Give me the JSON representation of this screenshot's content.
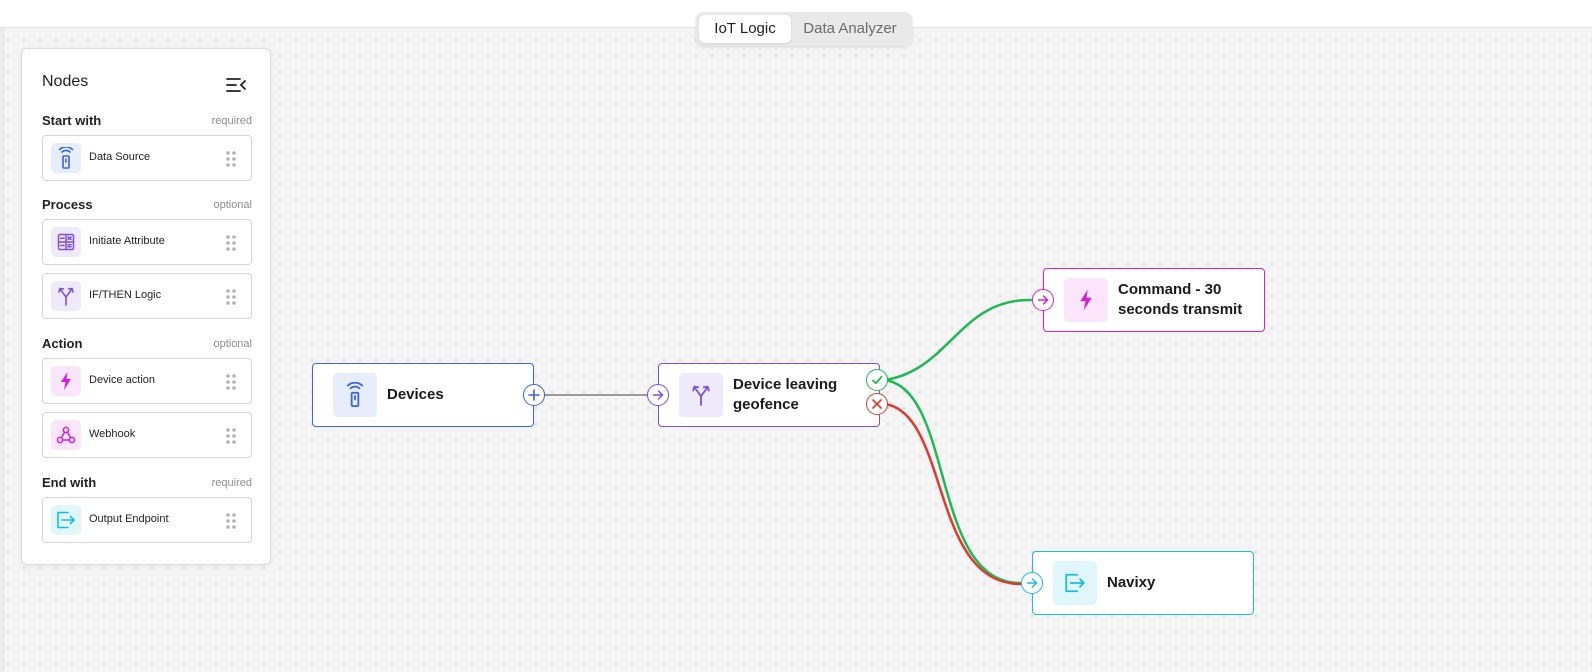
{
  "tabs": [
    "IoT Logic",
    "Data Analyzer"
  ],
  "active_tab": "IoT Logic",
  "panel": {
    "title": "Nodes",
    "sections": [
      {
        "name": "Start with",
        "tag": "required",
        "items": [
          {
            "label": "Data Source",
            "icon": "broadcast-tower-icon"
          }
        ]
      },
      {
        "name": "Process",
        "tag": "optional",
        "items": [
          {
            "label": "Initiate Attribute",
            "icon": "calculator-icon"
          },
          {
            "label": "IF/THEN Logic",
            "icon": "branch-icon"
          }
        ]
      },
      {
        "name": "Action",
        "tag": "optional",
        "items": [
          {
            "label": "Device action",
            "icon": "lightning-icon"
          },
          {
            "label": "Webhook",
            "icon": "webhook-icon"
          }
        ]
      },
      {
        "name": "End with",
        "tag": "required",
        "items": [
          {
            "label": "Output Endpoint",
            "icon": "exit-arrow-icon"
          }
        ]
      }
    ]
  },
  "canvas": {
    "nodes": [
      {
        "id": "devices",
        "label": "Devices",
        "type": "Data Source",
        "color": "#3b63e6"
      },
      {
        "id": "geofence",
        "label": "Device leaving geofence",
        "type": "IF/THEN Logic",
        "color": "#7b4fe0"
      },
      {
        "id": "command",
        "label": "Command - 30 seconds transmit",
        "type": "Device action",
        "color": "#d21fd6"
      },
      {
        "id": "navixy",
        "label": "Navixy",
        "type": "Output Endpoint",
        "color": "#18bfd8"
      }
    ],
    "edges": [
      {
        "from": "Devices",
        "to": "Device leaving geofence",
        "kind": "default",
        "color": "#9a9a9a"
      },
      {
        "from": "Device leaving geofence",
        "to": "Command - 30 seconds transmit",
        "kind": "true",
        "color": "#1db954"
      },
      {
        "from": "Device leaving geofence",
        "to": "Navixy",
        "kind": "true",
        "color": "#1db954"
      },
      {
        "from": "Device leaving geofence",
        "to": "Navixy",
        "kind": "false",
        "color": "#e03a2e"
      }
    ]
  }
}
